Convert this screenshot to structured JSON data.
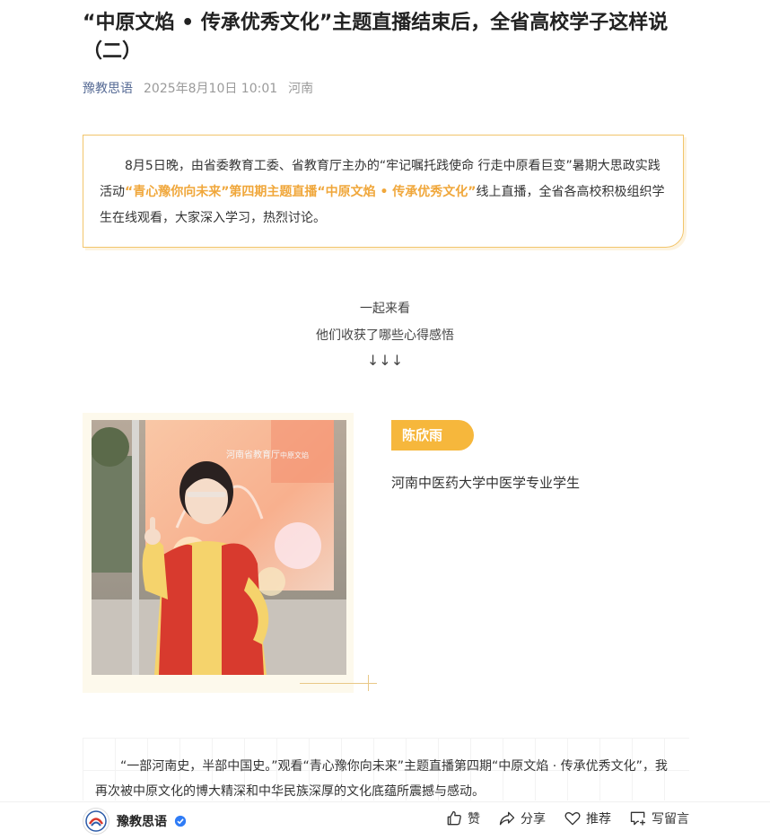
{
  "article": {
    "title": "“中原文焰 • 传承优秀文化”主题直播结束后，全省高校学子这样说（二）",
    "source": "豫教思语",
    "datetime": "2025年8月10日 10:01",
    "location": "河南"
  },
  "intro": {
    "part1": "8月5日晚，由省委教育工委、省教育厅主办的“牢记嘱托践使命 行走中原看巨变”暑期大思政实践活动",
    "highlight": "“青心豫你向未来”第四期主题直播“中原文焰 • 传承优秀文化”",
    "part2": "线上直播，全省各高校积极组织学生在线观看，大家深入学习，热烈讨论。"
  },
  "center": {
    "line1": "一起来看",
    "line2": "他们收获了哪些心得感悟",
    "arrows": "↓↓↓"
  },
  "student": {
    "name": "陈欣雨",
    "school": "河南中医药大学中医学专业学生",
    "banner_text1": "河南省教育厅",
    "banner_text2": "中原文焰"
  },
  "quote": {
    "text": "“一部河南史，半部中国史。”观看“青心豫你向未来”主题直播第四期“中原文焰 · 传承优秀文化”，我再次被中原文化的博大精深和中华民族深厚的文化底蕴所震撼与感动。"
  },
  "bottom_bar": {
    "account_name": "豫教思语",
    "like": "赞",
    "share": "分享",
    "recommend": "推荐",
    "comment": "写留言"
  },
  "colors": {
    "accent": "#f6b73c",
    "highlight_text": "#f0a73b",
    "link": "#576b95",
    "verified": "#2f7cf6"
  }
}
